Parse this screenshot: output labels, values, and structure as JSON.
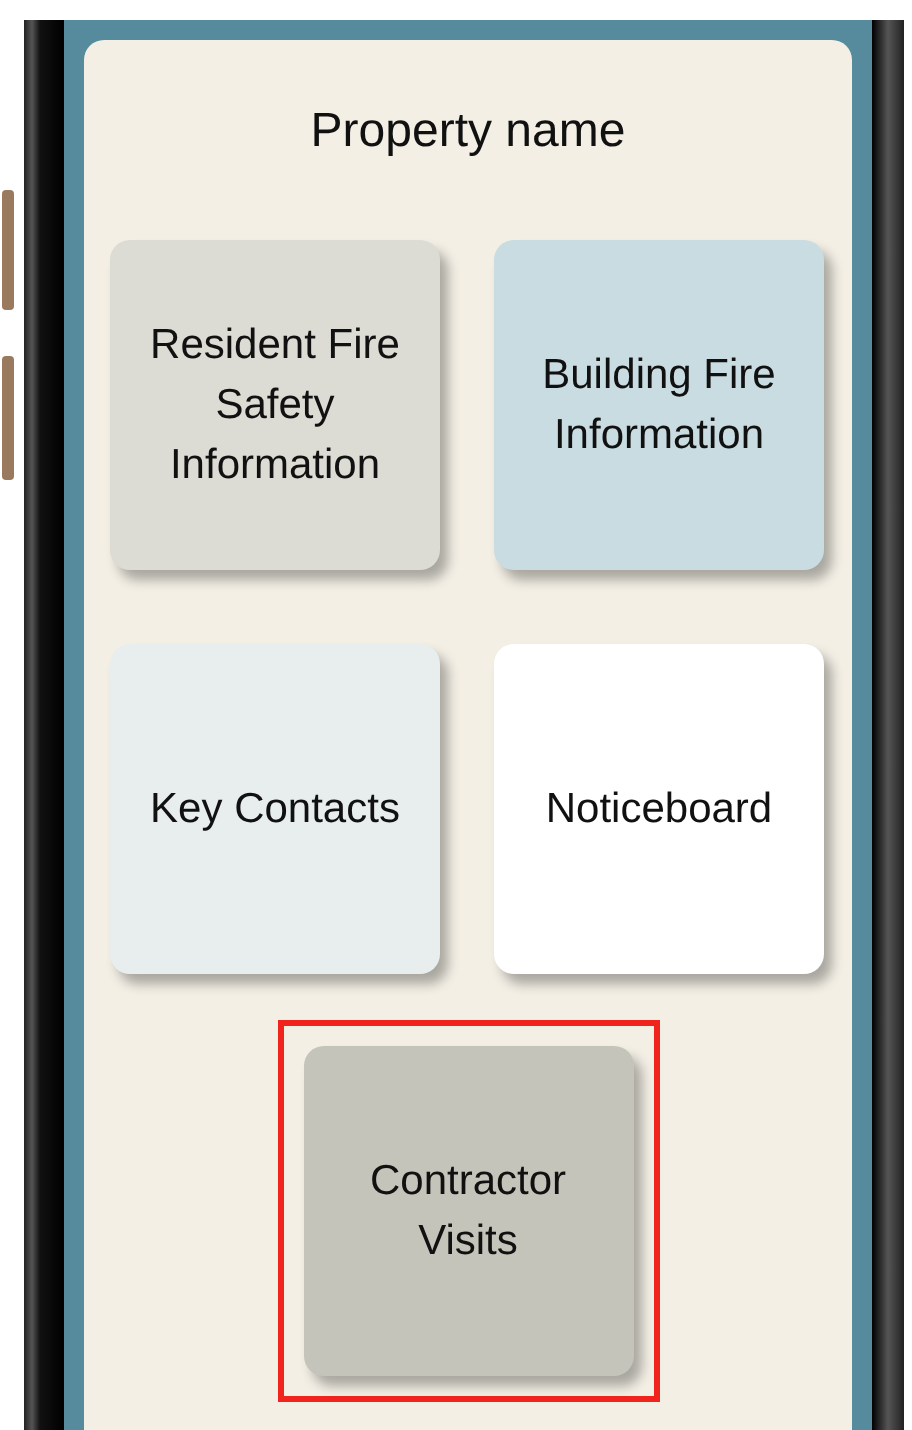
{
  "screen": {
    "title": "Property name"
  },
  "tiles": [
    {
      "label": "Resident Fire Safety Information",
      "color": "#dcdcd4"
    },
    {
      "label": "Building Fire Information",
      "color": "#c9dce2"
    },
    {
      "label": "Key Contacts",
      "color": "#e8eeee"
    },
    {
      "label": "Noticeboard",
      "color": "#ffffff"
    },
    {
      "label": "Contractor Visits",
      "color": "#c4c4ba",
      "highlighted": true
    }
  ]
}
